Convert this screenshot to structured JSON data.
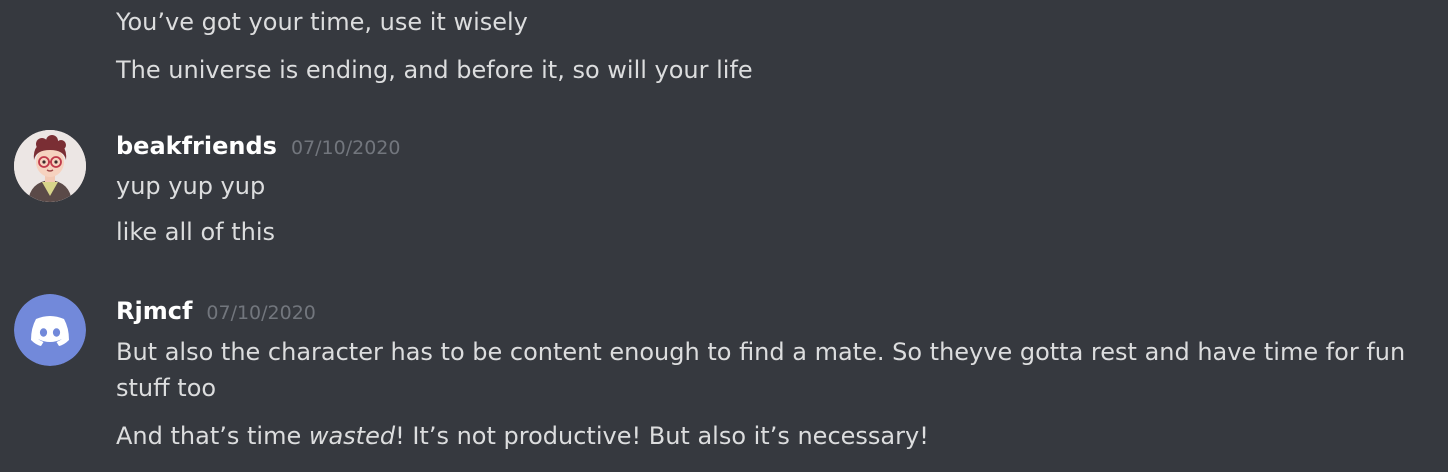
{
  "continuation": {
    "lines": [
      "You’ve got your time, use it wisely",
      "The universe is ending, and before it, so will your life"
    ]
  },
  "messages": [
    {
      "username": "beakfriends",
      "timestamp": "07/10/2020",
      "avatar_icon": "cartoon-person-avatar",
      "lines": [
        "yup yup yup",
        "like all of this"
      ]
    },
    {
      "username": "Rjmcf",
      "timestamp": "07/10/2020",
      "avatar_icon": "discord-default-avatar",
      "avatar_color": "#7289da",
      "line1": "But also the character has to be content enough to find a mate. So theyve gotta rest and have time for fun stuff too",
      "line2_before": "And that’s time ",
      "line2_em": "wasted",
      "line2_after": "! It’s not productive! But also it’s necessary!"
    }
  ]
}
